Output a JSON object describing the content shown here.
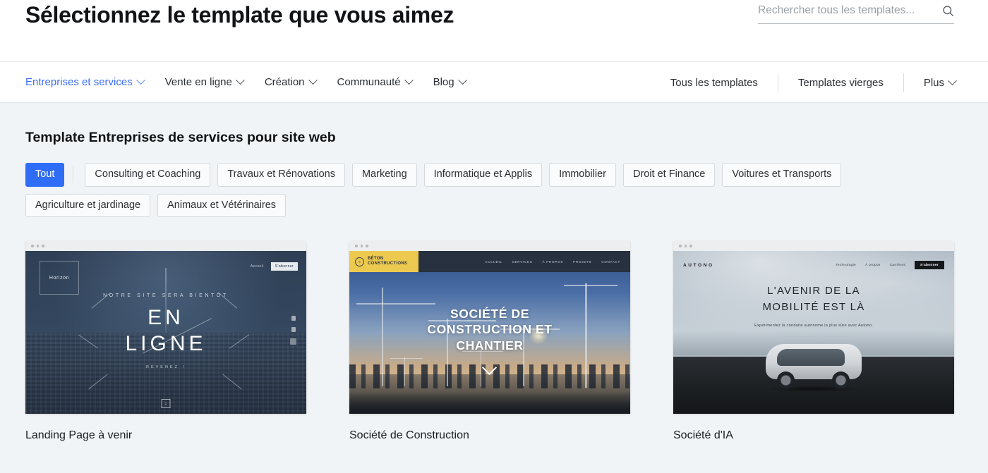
{
  "header": {
    "title": "Sélectionnez le template que vous aimez",
    "search": {
      "placeholder": "Rechercher tous les templates...",
      "value": "",
      "icon": "search-icon"
    }
  },
  "nav": {
    "left": [
      {
        "label": "Entreprises et services",
        "has_chevron": true,
        "active": true
      },
      {
        "label": "Vente en ligne",
        "has_chevron": true,
        "active": false
      },
      {
        "label": "Création",
        "has_chevron": true,
        "active": false
      },
      {
        "label": "Communauté",
        "has_chevron": true,
        "active": false
      },
      {
        "label": "Blog",
        "has_chevron": true,
        "active": false
      }
    ],
    "right": [
      {
        "label": "Tous les templates",
        "has_chevron": false
      },
      {
        "label": "Templates vierges",
        "has_chevron": false
      },
      {
        "label": "Plus",
        "has_chevron": true
      }
    ],
    "active_color": "#3b6ef5"
  },
  "main": {
    "section_title": "Template Entreprises de services pour site web",
    "filters_row1": [
      {
        "label": "Tout",
        "active": true
      },
      {
        "label": "Consulting et Coaching",
        "active": false
      },
      {
        "label": "Travaux et Rénovations",
        "active": false
      },
      {
        "label": "Marketing",
        "active": false
      },
      {
        "label": "Informatique et Applis",
        "active": false
      },
      {
        "label": "Immobilier",
        "active": false
      },
      {
        "label": "Droit et Finance",
        "active": false
      },
      {
        "label": "Voitures et Transports",
        "active": false
      }
    ],
    "filters_row2": [
      {
        "label": "Agriculture et jardinage",
        "active": false
      },
      {
        "label": "Animaux et Vétérinaires",
        "active": false
      }
    ],
    "active_chip_color": "#2f6df6",
    "cards": [
      {
        "title": "Landing Page à venir",
        "preview": {
          "logo": "Horizon",
          "nav": [
            "Accueil"
          ],
          "button": "S'abonner",
          "kicker": "NOTRE SITE SERA BIENTÔT",
          "headline_line1": "EN",
          "headline_line2": "LIGNE",
          "subtext": "REVENEZ !",
          "download_icon": "download-icon"
        }
      },
      {
        "title": "Société de Construction",
        "preview": {
          "logo_line1": "BÉTON",
          "logo_line2": "CONSTRUCTIONS",
          "nav": [
            "ACCUEIL",
            "SERVICES",
            "À PROPOS",
            "PROJETS",
            "CONTACT"
          ],
          "headline_line1": "SOCIÉTÉ DE",
          "headline_line2": "CONSTRUCTION ET",
          "headline_line3": "CHANTIER",
          "scroll_icon": "chevron-down-icon",
          "accent_color": "#ecc94f"
        }
      },
      {
        "title": "Société d'IA",
        "preview": {
          "logo": "AUTONO",
          "nav": [
            "Technologie",
            "À propos",
            "Carrières"
          ],
          "button": "S'abonner",
          "headline_line1": "L'AVENIR DE LA",
          "headline_line2": "MOBILITÉ EST LÀ",
          "subtext": "Expérimentez la conduite autonome la plus sûre avec Autono."
        }
      }
    ]
  }
}
